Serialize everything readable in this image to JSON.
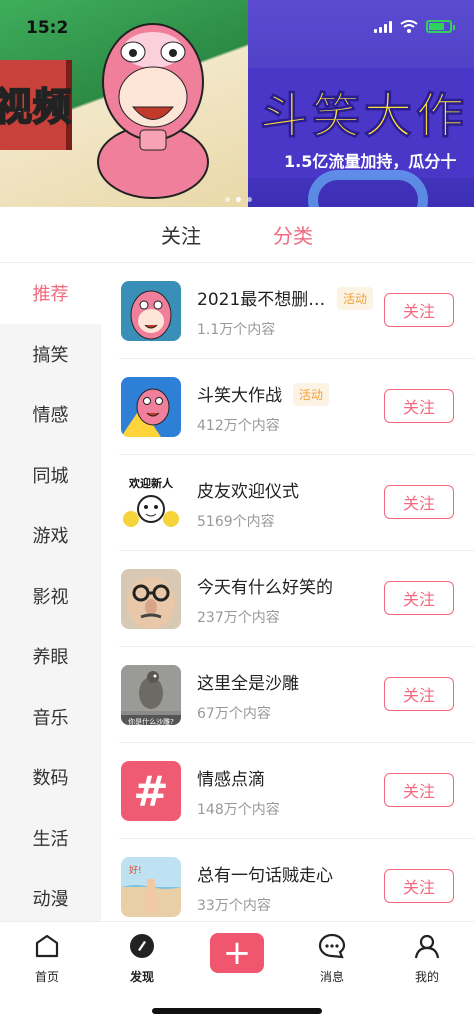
{
  "status_bar": {
    "time": "15:2"
  },
  "banner": {
    "left_text": "视频",
    "right_title": "斗笑大作",
    "right_subtitle": "1.5亿流量加持，瓜分十"
  },
  "top_tabs": [
    {
      "label": "关注",
      "active": false
    },
    {
      "label": "分类",
      "active": true
    }
  ],
  "sidebar": {
    "items": [
      {
        "label": "推荐",
        "active": true
      },
      {
        "label": "搞笑"
      },
      {
        "label": "情感"
      },
      {
        "label": "同城"
      },
      {
        "label": "游戏"
      },
      {
        "label": "影视"
      },
      {
        "label": "养眼"
      },
      {
        "label": "音乐"
      },
      {
        "label": "数码"
      },
      {
        "label": "生活"
      },
      {
        "label": "动漫"
      }
    ]
  },
  "list": {
    "follow_label": "关注",
    "items": [
      {
        "title": "2021最不想删…",
        "badge": "活动",
        "count": "1.1万个内容",
        "thumb": "pink-mascot"
      },
      {
        "title": "斗笑大作战",
        "badge": "活动",
        "count": "412万个内容",
        "thumb": "blue-mascot"
      },
      {
        "title": "皮友欢迎仪式",
        "count": "5169个内容",
        "thumb": "welcome-sticker",
        "thumb_text": "欢迎新人"
      },
      {
        "title": "今天有什么好笑的",
        "count": "237万个内容",
        "thumb": "glasses-face"
      },
      {
        "title": "这里全是沙雕",
        "count": "67万个内容",
        "thumb": "bird-photo",
        "thumb_text": "你是什么沙雕?"
      },
      {
        "title": "情感点滴",
        "count": "148万个内容",
        "thumb": "hash-icon",
        "thumb_text": "#"
      },
      {
        "title": "总有一句话贼走心",
        "count": "33万个内容",
        "thumb": "beach-photo"
      }
    ]
  },
  "bottom_nav": [
    {
      "label": "首页",
      "icon": "home-icon"
    },
    {
      "label": "发现",
      "icon": "compass-icon",
      "active": true
    },
    {
      "label": "",
      "icon": "plus-icon"
    },
    {
      "label": "消息",
      "icon": "chat-icon"
    },
    {
      "label": "我的",
      "icon": "user-icon"
    }
  ],
  "colors": {
    "accent": "#f26a7e",
    "badge": "#f0a23a"
  }
}
